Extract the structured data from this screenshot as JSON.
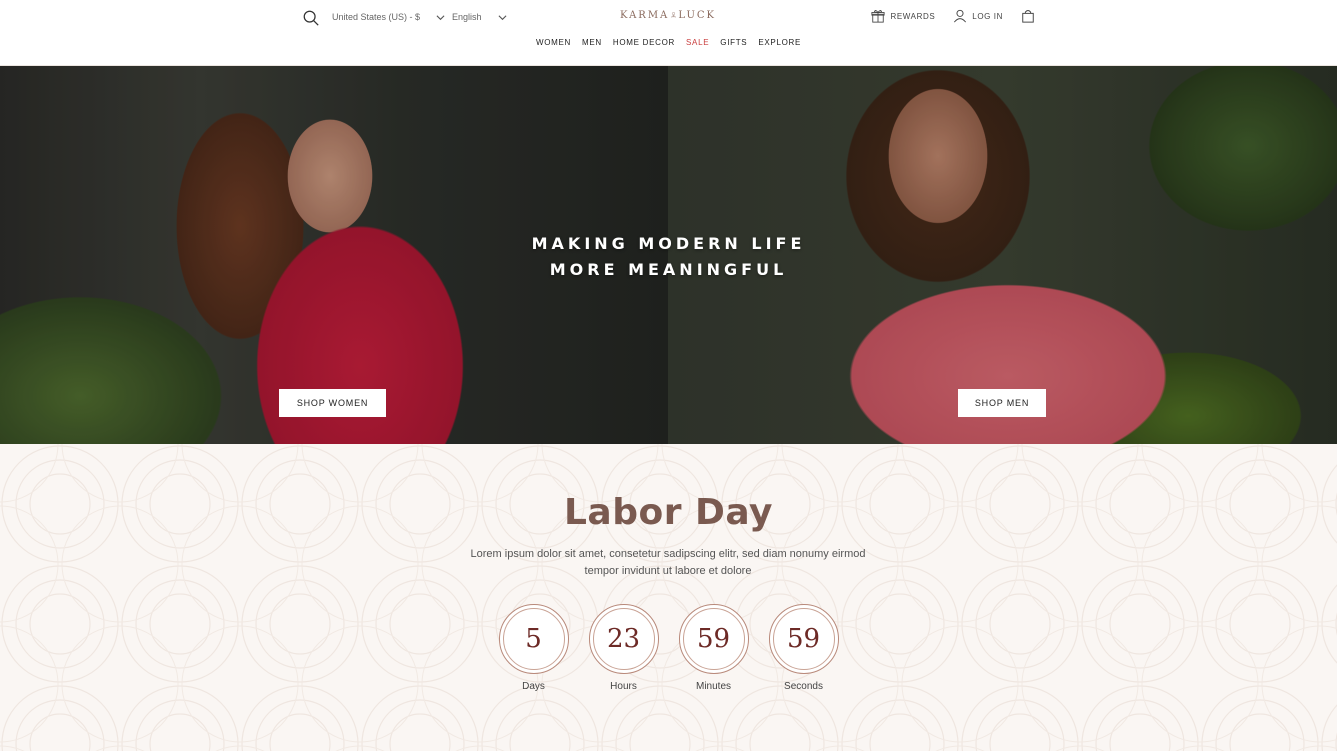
{
  "header": {
    "region": "United States (US) - $",
    "language": "English",
    "logo_left": "KARMA",
    "logo_right": "LUCK",
    "rewards": "REWARDS",
    "login": "LOG IN",
    "nav": [
      {
        "label": "WOMEN"
      },
      {
        "label": "MEN"
      },
      {
        "label": "HOME DECOR"
      },
      {
        "label": "SALE"
      },
      {
        "label": "GIFTS"
      },
      {
        "label": "EXPLORE"
      }
    ],
    "icons": [
      "search-icon",
      "chevron-down-icon",
      "lotus-logo-icon",
      "gift-icon",
      "user-icon",
      "shopping-bag-icon"
    ],
    "sale_color": "#c93c3c"
  },
  "hero": {
    "title_line1": "MAKING MODERN LIFE",
    "title_line2": "MORE MEANINGFUL",
    "shop_women": "SHOP WOMEN",
    "shop_men": "SHOP MEN"
  },
  "promo": {
    "title": "Labor Day",
    "text": "Lorem ipsum dolor sit amet, consetetur sadipscing elitr, sed diam nonumy eirmod tempor invidunt ut labore et dolore",
    "countdown": [
      {
        "value": "5",
        "label": "Days"
      },
      {
        "value": "23",
        "label": "Hours"
      },
      {
        "value": "59",
        "label": "Minutes"
      },
      {
        "value": "59",
        "label": "Seconds"
      }
    ],
    "accent_color": "#7a5a50"
  }
}
